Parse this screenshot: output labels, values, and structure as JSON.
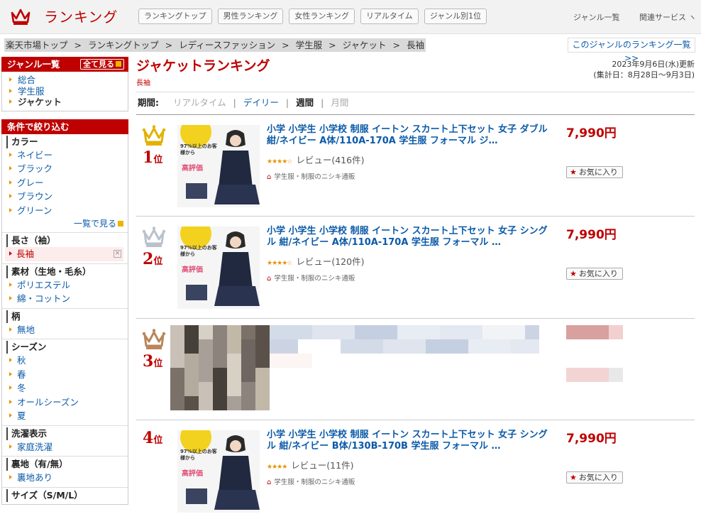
{
  "header": {
    "title": "ランキング",
    "tabs": [
      "ランキングトップ",
      "男性ランキング",
      "女性ランキング",
      "リアルタイム",
      "ジャンル別1位"
    ],
    "genre_list": "ジャンル一覧",
    "related": "関連サービス ヽ"
  },
  "breadcrumb": [
    "楽天市場トップ",
    "ランキングトップ",
    "レディースファッション",
    "学生服",
    "ジャケット",
    "長袖"
  ],
  "genre_ranking_link": "このジャンルのランキング一覧 >>",
  "sidebar": {
    "genre_head": "ジャンル一覧",
    "show_all": "全て見る",
    "genres": [
      "総合",
      "学生服",
      "ジャケット"
    ],
    "filter_head": "条件で絞り込む",
    "groups": [
      {
        "label": "カラー",
        "items": [
          "ネイビー",
          "ブラック",
          "グレー",
          "ブラウン",
          "グリーン"
        ],
        "more": "一覧で見る"
      },
      {
        "label": "長さ（袖）",
        "items": [
          "長袖"
        ],
        "selected": "長袖"
      },
      {
        "label": "素材（生地・毛糸）",
        "items": [
          "ポリエステル",
          "綿・コットン"
        ]
      },
      {
        "label": "柄",
        "items": [
          "無地"
        ]
      },
      {
        "label": "シーズン",
        "items": [
          "秋",
          "春",
          "冬",
          "オールシーズン",
          "夏"
        ]
      },
      {
        "label": "洗濯表示",
        "items": [
          "家庭洗濯"
        ]
      },
      {
        "label": "裏地（有/無）",
        "items": [
          "裏地あり"
        ]
      },
      {
        "label": "サイズ（S/M/L）",
        "items": []
      }
    ]
  },
  "main": {
    "title": "ジャケットランキング",
    "subtitle": "長袖",
    "updated": "2023年9月6日(水)更新",
    "period_range": "(集計日：8月28日〜9月3日)",
    "period_label": "期間:",
    "periods": [
      "リアルタイム",
      "デイリー",
      "週間",
      "月間"
    ],
    "active_period": "週間"
  },
  "items": [
    {
      "rank": "1",
      "rank_suffix": "位",
      "crown": "gold",
      "name": "小学 小学生 小学校 制服 イートン スカート上下セット 女子 ダブル 紺/ネイビー A体/110A-170A 学生服 フォーマル ジ…",
      "rating": 4.5,
      "review": "レビュー(416件)",
      "shop": "学生服・制服のニシキ通販",
      "price": "7,990円",
      "fav": "お気に入り",
      "thumb_badge": "97%以上のお客様から",
      "thumb_text": "高評価"
    },
    {
      "rank": "2",
      "rank_suffix": "位",
      "crown": "silver",
      "name": "小学 小学生 小学校 制服 イートン スカート上下セット 女子 シングル 紺/ネイビー A体/110A-170A 学生服 フォーマル …",
      "rating": 4.5,
      "review": "レビュー(120件)",
      "shop": "学生服・制服のニシキ通販",
      "price": "7,990円",
      "fav": "お気に入り",
      "thumb_badge": "97%以上のお客様から",
      "thumb_text": "高評価"
    },
    {
      "rank": "3",
      "rank_suffix": "位",
      "crown": "bronze",
      "blurred": true
    },
    {
      "rank": "4",
      "rank_suffix": "位",
      "crown": "plain",
      "name": "小学 小学生 小学校 制服 イートン スカート上下セット 女子 シングル 紺/ネイビー B体/130B-170B 学生服 フォーマル …",
      "rating": 4.0,
      "review": "レビュー(11件)",
      "shop": "学生服・制服のニシキ通販",
      "price": "7,990円",
      "fav": "お気に入り",
      "thumb_badge": "97%以上のお客様から",
      "thumb_text": "高評価"
    }
  ],
  "colors": {
    "brand_red": "#bf0000",
    "link_blue": "#0a5aa8",
    "gold": "#e2b200",
    "silver": "#b9c2cc",
    "bronze": "#b8875a"
  }
}
